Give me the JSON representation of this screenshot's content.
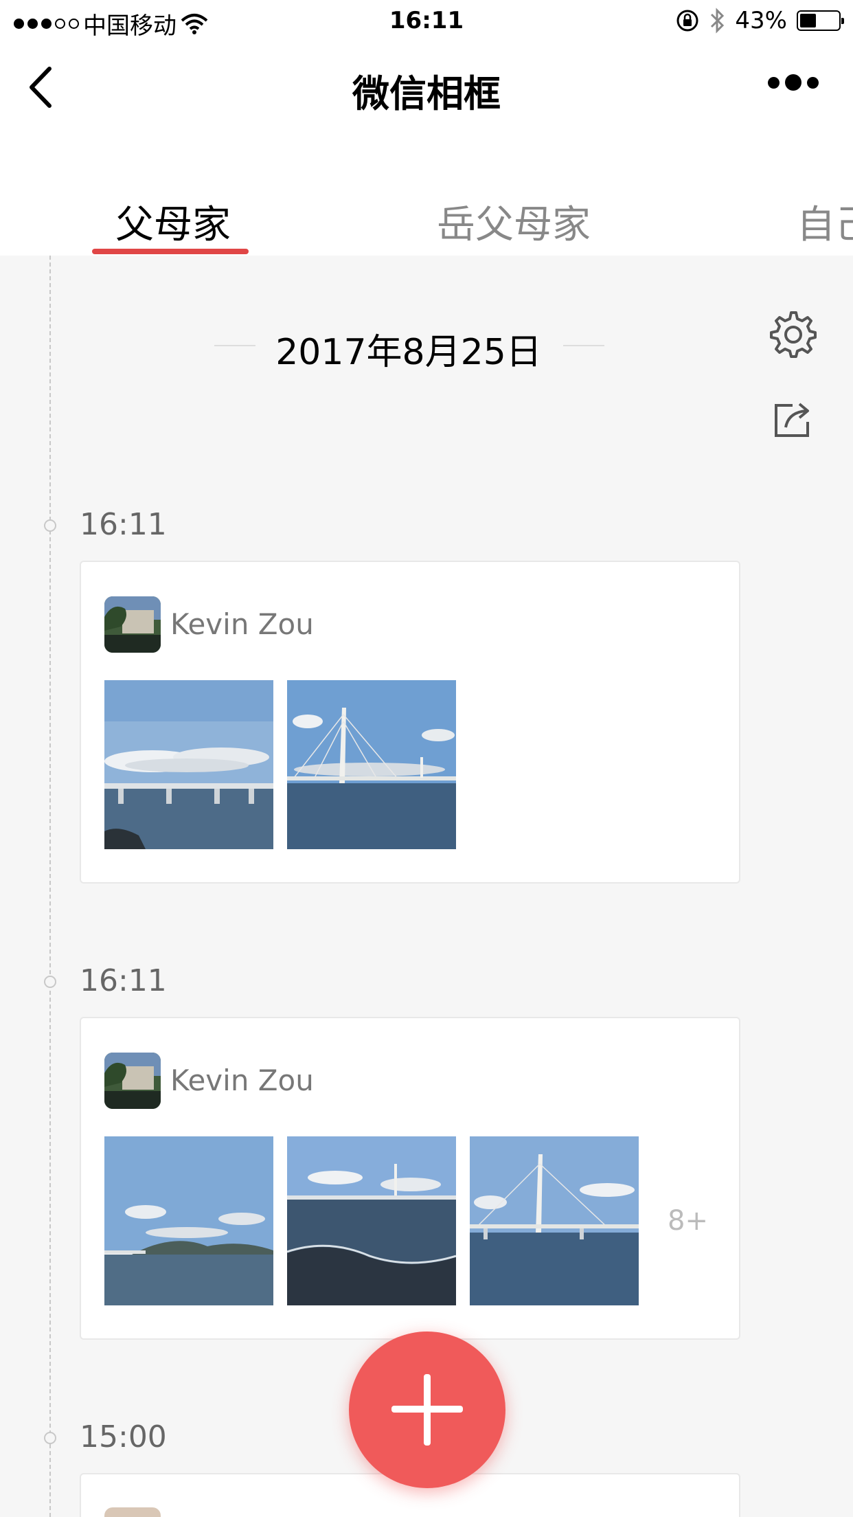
{
  "status_bar": {
    "carrier": "中国移动",
    "time": "16:11",
    "battery_percent": "43%",
    "battery_level": 0.43,
    "icons": [
      "signal-dots-icon",
      "wifi-icon",
      "orientation-lock-icon",
      "bluetooth-icon",
      "battery-icon"
    ]
  },
  "nav": {
    "title": "微信相框",
    "back_icon": "chevron-left-icon",
    "more_icon": "more-dots-icon"
  },
  "tabs": [
    {
      "label": "父母家",
      "active": true
    },
    {
      "label": "岳父母家",
      "active": false
    },
    {
      "label": "自己",
      "active": false
    }
  ],
  "accent_color": "#e04646",
  "fab_color": "#f05a5a",
  "date_header": "2017年8月25日",
  "side_tools": [
    "settings-gear-icon",
    "share-icon"
  ],
  "posts": [
    {
      "time": "16:11",
      "author": "Kevin Zou",
      "photos": [
        "bridge-clouds-photo",
        "cable-stayed-bridge-photo"
      ]
    },
    {
      "time": "16:11",
      "author": "Kevin Zou",
      "photos": [
        "sea-mountains-photo",
        "waves-bridge-photo",
        "bridge-tower-photo"
      ],
      "more_count": "8+"
    },
    {
      "time": "15:00"
    }
  ],
  "fab": {
    "icon": "plus-icon"
  }
}
